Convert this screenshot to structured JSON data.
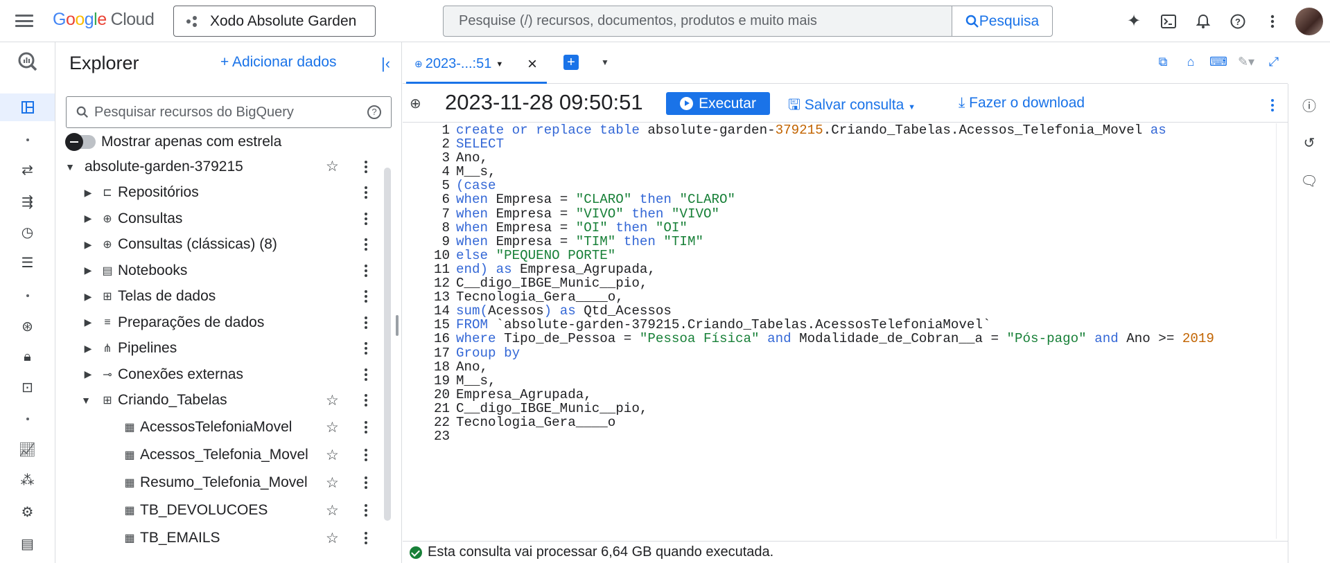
{
  "header": {
    "logo": {
      "google": "Google",
      "cloud": "Cloud"
    },
    "project_name": "Xodo Absolute Garden",
    "search_placeholder": "Pesquise (/) recursos, documentos, produtos e muito mais",
    "search_button": "Pesquisa",
    "icons": [
      "gemini-icon",
      "cloud-shell-icon",
      "notifications-icon",
      "help-icon",
      "more-vert-icon",
      "avatar"
    ]
  },
  "left_rail": {
    "icons": [
      "bigquery-logo-icon",
      "overview-icon",
      "transfers-icon",
      "pipelines-icon",
      "history-icon",
      "queries-icon",
      "dataform-icon",
      "security-icon",
      "catalog-icon",
      "monitoring-icon",
      "graph-icon",
      "settings-icon",
      "release-notes-icon"
    ]
  },
  "explorer": {
    "title": "Explorer",
    "add_data": "Adicionar dados",
    "search_placeholder": "Pesquisar recursos do BigQuery",
    "starred_toggle_label": "Mostrar apenas com estrela",
    "project": "absolute-garden-379215",
    "nodes": [
      {
        "label": "Repositórios",
        "icon": "repository-icon"
      },
      {
        "label": "Consultas",
        "icon": "query-icon"
      },
      {
        "label": "Consultas (clássicas) (8)",
        "icon": "query-icon"
      },
      {
        "label": "Notebooks",
        "icon": "notebook-icon"
      },
      {
        "label": "Telas de dados",
        "icon": "canvas-icon"
      },
      {
        "label": "Preparações de dados",
        "icon": "data-prep-icon"
      },
      {
        "label": "Pipelines",
        "icon": "pipeline-icon"
      },
      {
        "label": "Conexões externas",
        "icon": "connection-icon"
      }
    ],
    "dataset": "Criando_Tabelas",
    "tables": [
      "AcessosTelefoniaMovel",
      "Acessos_Telefonia_Movel",
      "Resumo_Telefonia_Movel",
      "TB_DEVOLUCOES",
      "TB_EMAILS"
    ]
  },
  "tabs": {
    "active_tab": "2023-...:51"
  },
  "query_toolbar": {
    "title": "2023-11-28 09:50:51",
    "run": "Executar",
    "save": "Salvar consulta",
    "download": "Fazer o download"
  },
  "editor": {
    "line_numbers": [
      "1",
      "2",
      "3",
      "4",
      "5",
      "6",
      "7",
      "8",
      "9",
      "10",
      "11",
      "12",
      "13",
      "14",
      "15",
      "16",
      "17",
      "18",
      "19",
      "20",
      "21",
      "22",
      "23"
    ],
    "lines": [
      "create or replace table absolute-garden-379215.Criando_Tabelas.Acessos_Telefonia_Movel as",
      "SELECT",
      "Ano,",
      "M__s,",
      "(case",
      "when Empresa = \"CLARO\" then \"CLARO\"",
      "when Empresa = \"VIVO\" then \"VIVO\"",
      "when Empresa = \"OI\" then \"OI\"",
      "when Empresa = \"TIM\" then \"TIM\"",
      "else \"PEQUENO PORTE\"",
      "end) as Empresa_Agrupada,",
      "C__digo_IBGE_Munic__pio,",
      "Tecnologia_Gera____o,",
      "sum(Acessos) as Qtd_Acessos",
      "FROM `absolute-garden-379215.Criando_Tabelas.AcessosTelefoniaMovel`",
      "where Tipo_de_Pessoa = \"Pessoa Física\" and Modalidade_de_Cobran__a = \"Pós-pago\" and Ano >= 2019",
      "Group by",
      "Ano,",
      "M__s,",
      "Empresa_Agrupada,",
      "C__digo_IBGE_Munic__pio,",
      "Tecnologia_Gera____o",
      ""
    ]
  },
  "status": {
    "message": "Esta consulta vai processar 6,64 GB quando executada."
  },
  "colors": {
    "accent": "#1a73e8",
    "keyword": "#3367d6",
    "string": "#188038",
    "number": "#c26401"
  }
}
